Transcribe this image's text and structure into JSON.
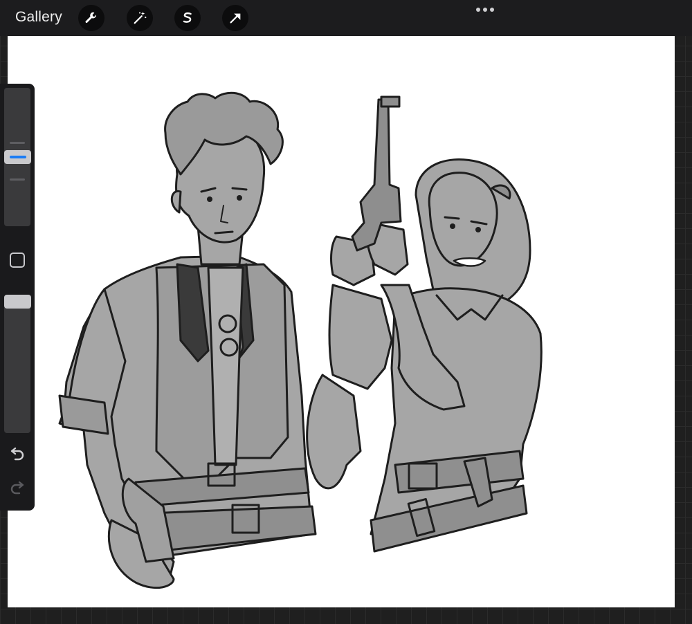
{
  "toolbar": {
    "gallery_label": "Gallery",
    "tools": [
      {
        "name": "wrench-icon"
      },
      {
        "name": "magic-wand-icon"
      },
      {
        "name": "selection-s-icon"
      },
      {
        "name": "transform-arrow-icon"
      }
    ],
    "more_icon": "ellipsis-icon"
  },
  "sidebar": {
    "brush_size_level": 0.5,
    "opacity_level": 1.0,
    "icons": [
      "square-modify-icon",
      "undo-icon",
      "redo-icon"
    ]
  },
  "colors": {
    "toolbar_bg": "#1c1c1e",
    "accent": "#1a7cf5",
    "canvas": "#ffffff",
    "sketch_fill": "#a6a6a6",
    "ink": "#1e1e1e"
  }
}
